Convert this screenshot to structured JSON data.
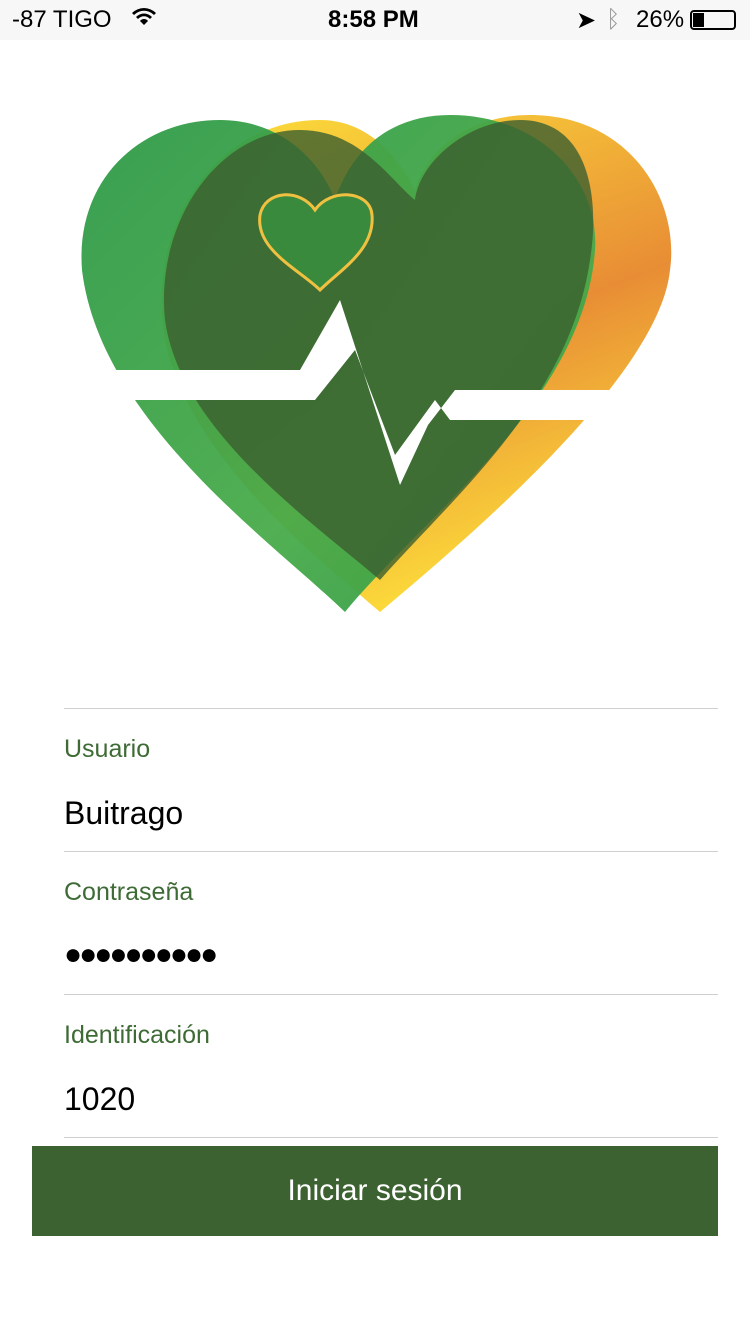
{
  "status_bar": {
    "carrier": "-87 TIGO",
    "time": "8:58 PM",
    "battery": "26%",
    "battery_level": 26
  },
  "colors": {
    "accent": "#3d6232",
    "label": "#3e6b35"
  },
  "form": {
    "fields": [
      {
        "label": "Usuario",
        "value": "Buitrago"
      },
      {
        "label": "Contraseña",
        "value": "●●●●●●●●●●"
      },
      {
        "label": "Identificación",
        "value": "1020"
      }
    ],
    "submit_label": "Iniciar sesión"
  }
}
